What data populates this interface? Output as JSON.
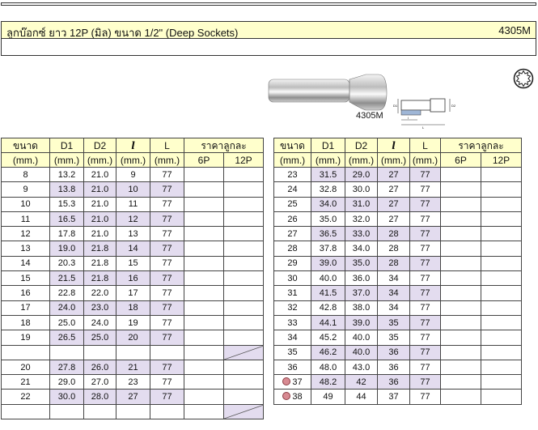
{
  "header": {
    "title": "ลูกบ๊อกซ์ ยาว 12P (มิล) ขนาด 1/2\" (Deep Sockets)",
    "code": "4305M"
  },
  "figure": {
    "model_label": "4305M",
    "dim_labels": [
      "D1",
      "D2",
      "l",
      "L"
    ]
  },
  "table": {
    "columns": [
      "ขนาด",
      "D1",
      "D2",
      "l",
      "L",
      "ราคาลูกละ"
    ],
    "units": [
      "(mm.)",
      "(mm.)",
      "(mm.)",
      "(mm.)",
      "(mm.)"
    ],
    "price_cols": [
      "6P",
      "12P"
    ],
    "left_rows": [
      {
        "size": "8",
        "d1": "13.2",
        "d2": "21.0",
        "l": "9",
        "L": "77"
      },
      {
        "size": "9",
        "d1": "13.8",
        "d2": "21.0",
        "l": "10",
        "L": "77"
      },
      {
        "size": "10",
        "d1": "15.3",
        "d2": "21.0",
        "l": "11",
        "L": "77"
      },
      {
        "size": "11",
        "d1": "16.5",
        "d2": "21.0",
        "l": "12",
        "L": "77"
      },
      {
        "size": "12",
        "d1": "17.8",
        "d2": "21.0",
        "l": "13",
        "L": "77"
      },
      {
        "size": "13",
        "d1": "19.0",
        "d2": "21.8",
        "l": "14",
        "L": "77"
      },
      {
        "size": "14",
        "d1": "20.3",
        "d2": "21.8",
        "l": "15",
        "L": "77"
      },
      {
        "size": "15",
        "d1": "21.5",
        "d2": "21.8",
        "l": "16",
        "L": "77"
      },
      {
        "size": "16",
        "d1": "22.8",
        "d2": "22.0",
        "l": "17",
        "L": "77"
      },
      {
        "size": "17",
        "d1": "24.0",
        "d2": "23.0",
        "l": "18",
        "L": "77"
      },
      {
        "size": "18",
        "d1": "25.0",
        "d2": "24.0",
        "l": "19",
        "L": "77"
      },
      {
        "size": "19",
        "d1": "26.5",
        "d2": "25.0",
        "l": "20",
        "L": "77"
      },
      {
        "size": "",
        "d1": "",
        "d2": "",
        "l": "",
        "L": ""
      },
      {
        "size": "20",
        "d1": "27.8",
        "d2": "26.0",
        "l": "21",
        "L": "77"
      },
      {
        "size": "21",
        "d1": "29.0",
        "d2": "27.0",
        "l": "23",
        "L": "77"
      },
      {
        "size": "22",
        "d1": "30.0",
        "d2": "28.0",
        "l": "27",
        "L": "77"
      },
      {
        "size": "",
        "d1": "",
        "d2": "",
        "l": "",
        "L": ""
      }
    ],
    "right_rows": [
      {
        "size": "23",
        "d1": "31.5",
        "d2": "29.0",
        "l": "27",
        "L": "77"
      },
      {
        "size": "24",
        "d1": "32.8",
        "d2": "30.0",
        "l": "27",
        "L": "77"
      },
      {
        "size": "25",
        "d1": "34.0",
        "d2": "31.0",
        "l": "27",
        "L": "77"
      },
      {
        "size": "26",
        "d1": "35.0",
        "d2": "32.0",
        "l": "27",
        "L": "77"
      },
      {
        "size": "27",
        "d1": "36.5",
        "d2": "33.0",
        "l": "28",
        "L": "77"
      },
      {
        "size": "28",
        "d1": "37.8",
        "d2": "34.0",
        "l": "28",
        "L": "77"
      },
      {
        "size": "29",
        "d1": "39.0",
        "d2": "35.0",
        "l": "28",
        "L": "77"
      },
      {
        "size": "30",
        "d1": "40.0",
        "d2": "36.0",
        "l": "34",
        "L": "77"
      },
      {
        "size": "31",
        "d1": "41.5",
        "d2": "37.0",
        "l": "34",
        "L": "77"
      },
      {
        "size": "32",
        "d1": "42.8",
        "d2": "38.0",
        "l": "34",
        "L": "77"
      },
      {
        "size": "33",
        "d1": "44.1",
        "d2": "39.0",
        "l": "35",
        "L": "77"
      },
      {
        "size": "34",
        "d1": "45.2",
        "d2": "40.0",
        "l": "35",
        "L": "77"
      },
      {
        "size": "35",
        "d1": "46.2",
        "d2": "40.0",
        "l": "36",
        "L": "77"
      },
      {
        "size": "36",
        "d1": "48.0",
        "d2": "43.0",
        "l": "36",
        "L": "77"
      },
      {
        "size": "37",
        "d1": "48.2",
        "d2": "42",
        "l": "36",
        "L": "77"
      },
      {
        "size": "38",
        "d1": "49",
        "d2": "44",
        "l": "37",
        "L": "77"
      }
    ]
  },
  "colors": {
    "header_bg": "#ffffcc",
    "row_highlight": "#e3dcef",
    "dot": "#d88a92"
  }
}
